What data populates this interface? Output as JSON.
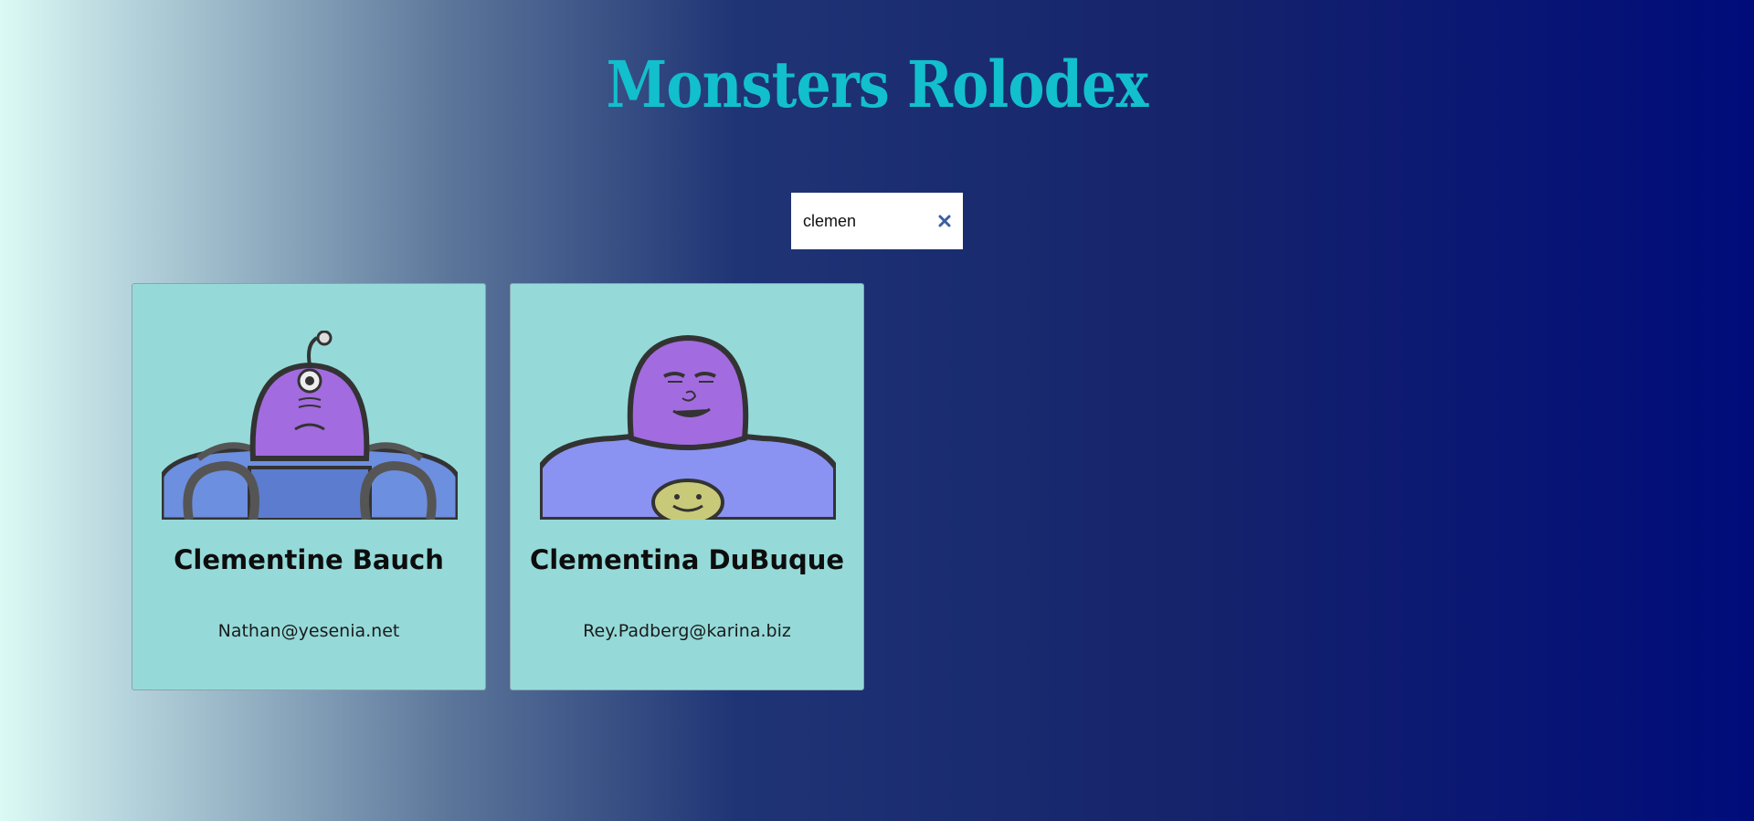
{
  "header": {
    "title": "Monsters Rolodex"
  },
  "search": {
    "value": "clemen",
    "clear_icon": "close-icon"
  },
  "monsters": [
    {
      "name": "Clementine Bauch",
      "email": "Nathan@yesenia.net",
      "avatar_icon": "robot-monster-avatar"
    },
    {
      "name": "Clementina DuBuque",
      "email": "Rey.Padberg@karina.biz",
      "avatar_icon": "robot-monster-avatar"
    }
  ],
  "colors": {
    "title": "#12bfcd",
    "card_background": "#95dad9",
    "monster_head": "#a36be0",
    "monster_body": "#6f8be0",
    "clear_icon": "#3b5fa0"
  }
}
